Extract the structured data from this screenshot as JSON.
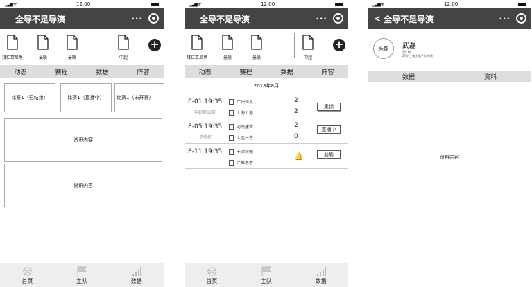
{
  "status": {
    "time": "12:00"
  },
  "app_title": "全导不是导演",
  "more_label": "···",
  "follow": [
    {
      "label": "拜仁慕尼黑"
    },
    {
      "label": "曼联"
    },
    {
      "label": "曼联"
    },
    {
      "label": "中超"
    }
  ],
  "add_label": "+",
  "tabs": [
    "动态",
    "赛程",
    "数据",
    "阵容"
  ],
  "screen1": {
    "cards": [
      "比赛1（已结束）",
      "比赛1（直播中）",
      "比赛1（未开赛）"
    ],
    "news": [
      "资讯内容",
      "资讯内容"
    ]
  },
  "screen2": {
    "month": "2018年8月",
    "matches": [
      {
        "time": "8-01 19:35",
        "comp": "中超第12轮",
        "home": "广州恒大",
        "away": "上海上港",
        "home_score": "2",
        "away_score": "2",
        "action": "集锦"
      },
      {
        "time": "8-05 19:35",
        "comp": "足协杯",
        "home": "河南建业",
        "away": "大连一方",
        "home_score": "2",
        "away_score": "0",
        "action": "直播中"
      },
      {
        "time": "8-11 19:35",
        "comp": "",
        "home": "天津权健",
        "away": "江苏苏宁",
        "home_score": "",
        "away_score": "",
        "action": "前瞻"
      }
    ]
  },
  "screen3": {
    "back": "<",
    "title": "全导不是导演",
    "avatar": "头像",
    "name": "武磊",
    "pinyin": "Wu Lei",
    "info": "27岁/上海上港/7号/中场",
    "tabs": [
      "数据",
      "资料"
    ],
    "content": "资料内容"
  },
  "tabbar": [
    {
      "label": "首页",
      "icon": "soccer-ball-icon"
    },
    {
      "label": "主队",
      "icon": "flag-icon"
    },
    {
      "label": "数据",
      "icon": "signal-bars-icon"
    }
  ]
}
